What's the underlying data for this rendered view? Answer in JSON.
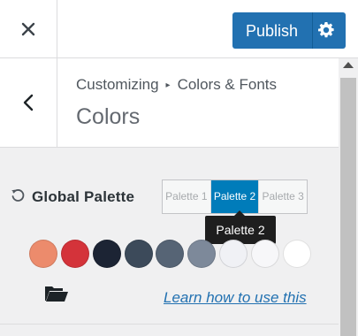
{
  "header": {
    "close_icon": "close-icon",
    "publish_label": "Publish",
    "settings_icon": "gear-icon"
  },
  "section": {
    "breadcrumb_root": "Customizing",
    "breadcrumb_separator": "▸",
    "breadcrumb_current": "Colors & Fonts",
    "title": "Colors"
  },
  "global_palette": {
    "label": "Global Palette",
    "tabs": [
      "Palette 1",
      "Palette 2",
      "Palette 3"
    ],
    "active_tab": "Palette 2",
    "tooltip": "Palette 2",
    "swatches": [
      "#ec8b6c",
      "#d4333a",
      "#1c2434",
      "#3c4a5a",
      "#566475",
      "#7d899a",
      "#f0f1f5",
      "#f7f7f9",
      "#ffffff"
    ]
  },
  "footer": {
    "learn_link": "Learn how to use this"
  }
}
